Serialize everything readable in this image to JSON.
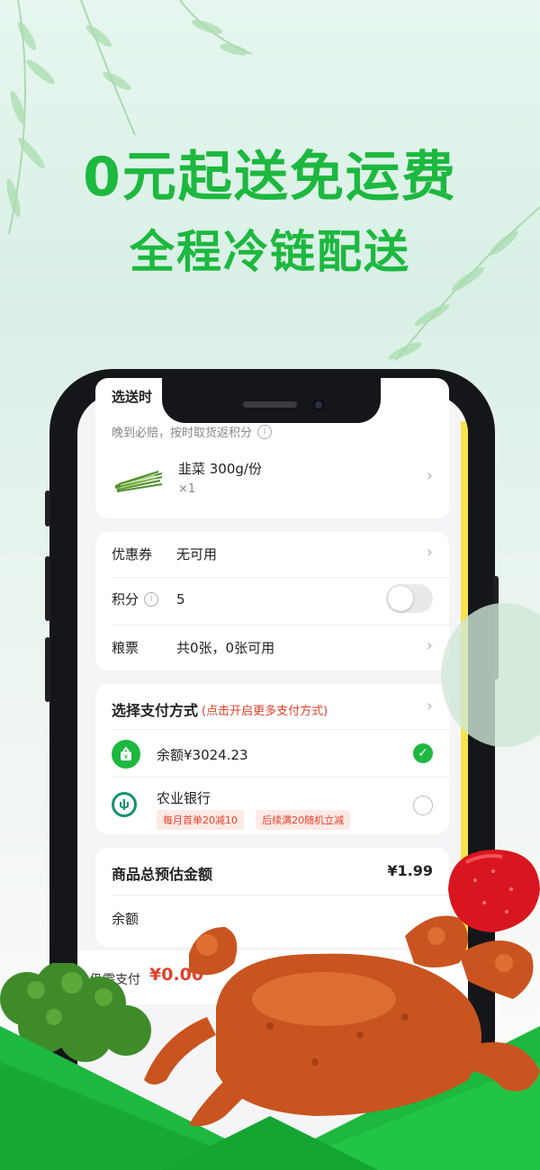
{
  "headline": {
    "line1": "0元起送免运费",
    "line2": "全程冷链配送"
  },
  "order": {
    "header_partial": "选送时",
    "notice": "晚到必赔，按时取货返积分",
    "product": {
      "name": "韭菜 300g/份",
      "qty": "×1"
    }
  },
  "discounts": {
    "coupon_label": "优惠券",
    "coupon_value": "无可用",
    "points_label": "积分",
    "points_value": "5",
    "grain_label": "粮票",
    "grain_value": "共0张，0张可用"
  },
  "payment": {
    "title": "选择支付方式",
    "hint": "(点击开启更多支付方式)",
    "balance_label": "余额¥3024.23",
    "bank_name": "农业银行",
    "bank_tags": [
      "每月首单20减10",
      "后续满20随机立减"
    ]
  },
  "summary": {
    "total_label": "商品总预估金额",
    "total_value": "¥1.99",
    "balance_label": "余额"
  },
  "footer": {
    "remaining_label": "仍需支付",
    "remaining_value": "¥0.00"
  },
  "colors": {
    "brand_green": "#1db83f",
    "accent_red": "#e2412b"
  }
}
